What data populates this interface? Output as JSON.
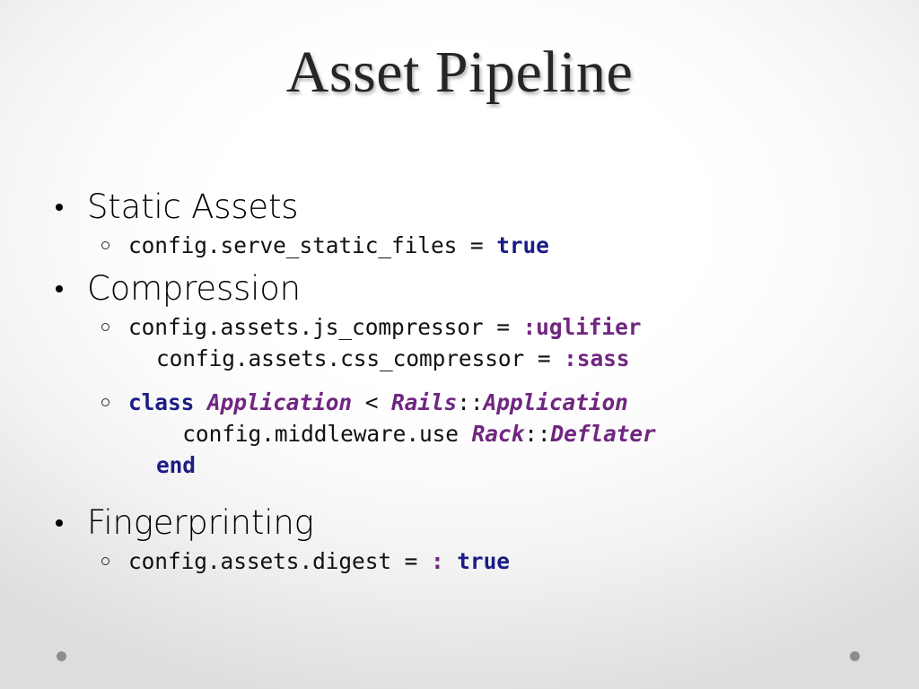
{
  "slide": {
    "title": "Asset Pipeline",
    "background_center": "#ffffff",
    "background_edge": "#dddddd",
    "title_color": "#272525"
  },
  "colors": {
    "keyword_blue": "#1c1c87",
    "symbol_purple": "#702680",
    "body_black": "#000000",
    "deco_dot_gray": "#8d8d8d"
  },
  "content": {
    "sections": [
      {
        "heading": "Static Assets",
        "code_blocks": [
          {
            "lines": [
              {
                "parts": [
                  {
                    "t": "config.serve_static_files = ",
                    "c": "op"
                  },
                  {
                    "t": "true",
                    "c": "val"
                  }
                ]
              }
            ]
          }
        ]
      },
      {
        "heading": "Compression",
        "code_blocks": [
          {
            "lines": [
              {
                "parts": [
                  {
                    "t": "config.assets.js_compressor = ",
                    "c": "op"
                  },
                  {
                    "t": ":uglifier",
                    "c": "sym"
                  }
                ]
              },
              {
                "indent": 1,
                "parts": [
                  {
                    "t": "config.assets.css_compressor = ",
                    "c": "op"
                  },
                  {
                    "t": ":sass",
                    "c": "sym"
                  }
                ]
              }
            ]
          },
          {
            "lines": [
              {
                "parts": [
                  {
                    "t": "class ",
                    "c": "kw"
                  },
                  {
                    "t": "Application",
                    "c": "cls"
                  },
                  {
                    "t": " < ",
                    "c": "op"
                  },
                  {
                    "t": "Rails",
                    "c": "cls"
                  },
                  {
                    "t": "::",
                    "c": "op"
                  },
                  {
                    "t": "Application",
                    "c": "cls"
                  }
                ]
              },
              {
                "indent": 1,
                "parts": [
                  {
                    "t": "  config.middleware.use ",
                    "c": "op"
                  },
                  {
                    "t": "Rack",
                    "c": "cls"
                  },
                  {
                    "t": "::",
                    "c": "op"
                  },
                  {
                    "t": "Deflater",
                    "c": "cls"
                  }
                ]
              },
              {
                "indent": 1,
                "parts": [
                  {
                    "t": "end",
                    "c": "kw"
                  }
                ]
              }
            ]
          }
        ]
      },
      {
        "heading": "Fingerprinting",
        "code_blocks": [
          {
            "lines": [
              {
                "parts": [
                  {
                    "t": "config.assets.digest = ",
                    "c": "op"
                  },
                  {
                    "t": ":",
                    "c": "sym"
                  },
                  {
                    "t": " ",
                    "c": "op"
                  },
                  {
                    "t": "true",
                    "c": "val"
                  }
                ]
              }
            ]
          }
        ]
      }
    ]
  },
  "decoration": {
    "bullet_glyph": "•",
    "sub_bullet_glyph": "○",
    "dot_left_label": "decorative-dot-left",
    "dot_right_label": "decorative-dot-right"
  }
}
